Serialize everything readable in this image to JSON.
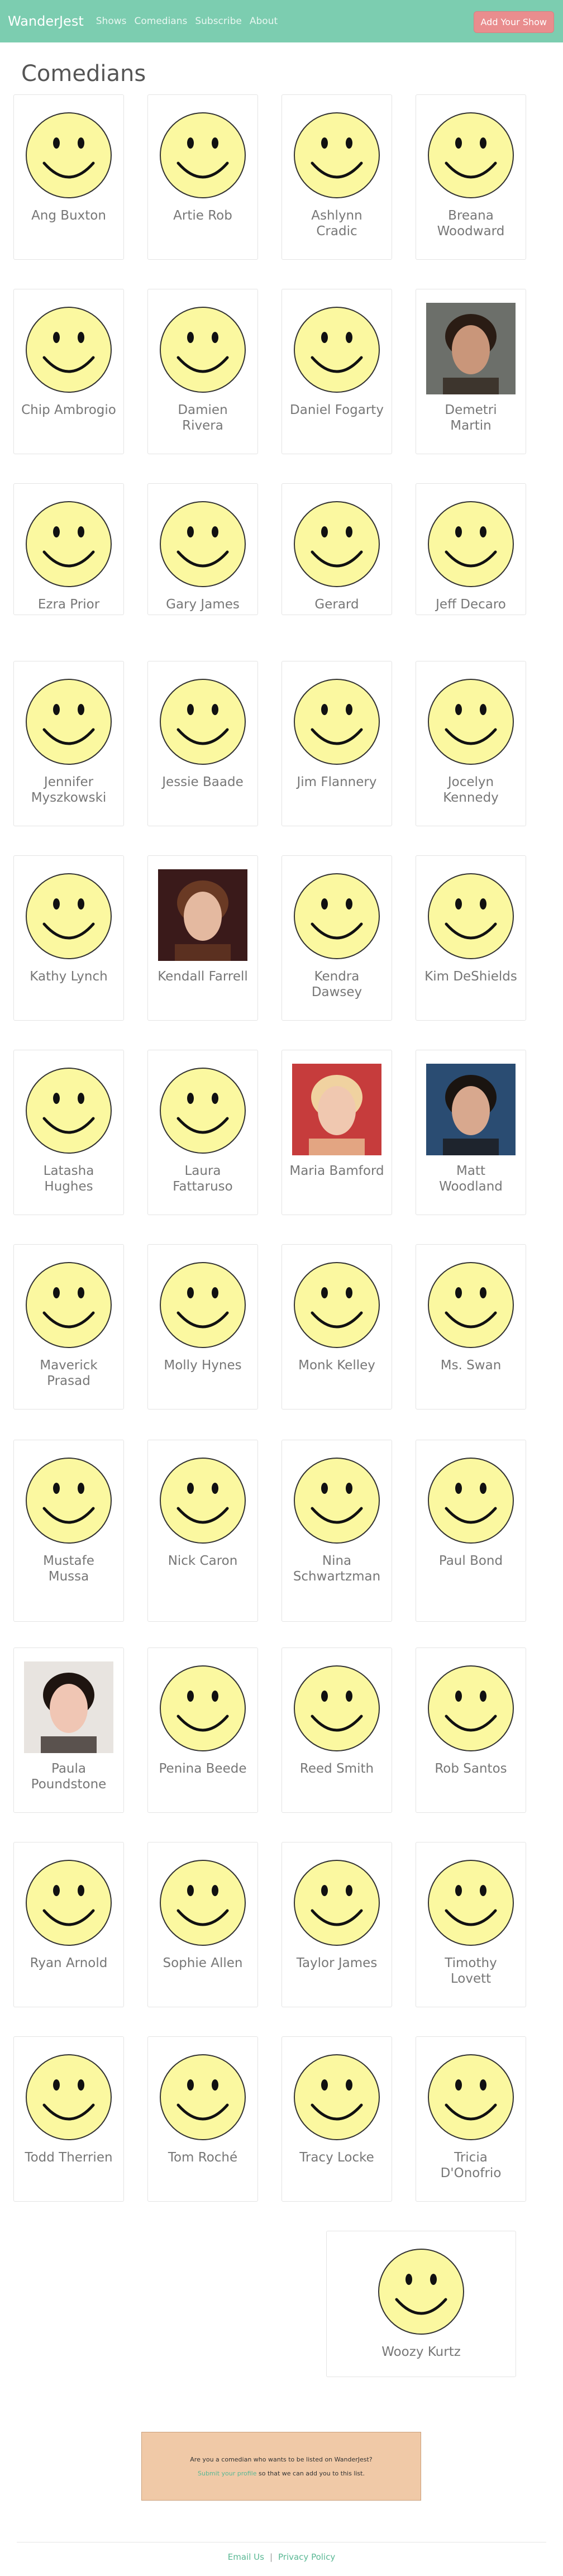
{
  "nav": {
    "brand": "WanderJest",
    "links": [
      "Shows",
      "Comedians",
      "Subscribe",
      "About"
    ],
    "cta": "Add Your Show"
  },
  "page": {
    "title": "Comedians"
  },
  "comedians": [
    {
      "name": "Ang Buxton",
      "photo": "smiley"
    },
    {
      "name": "Artie Rob",
      "photo": "smiley"
    },
    {
      "name": "Ashlynn Cradic",
      "photo": "smiley"
    },
    {
      "name": "Breana Woodward",
      "photo": "smiley"
    },
    {
      "name": "Chip Ambrogio",
      "photo": "smiley"
    },
    {
      "name": "Damien Rivera",
      "photo": "smiley"
    },
    {
      "name": "Daniel Fogarty",
      "photo": "smiley"
    },
    {
      "name": "Demetri Martin",
      "photo": "portrait"
    },
    {
      "name": "Ezra Prior",
      "photo": "smiley"
    },
    {
      "name": "Gary James",
      "photo": "smiley"
    },
    {
      "name": "Gerard",
      "photo": "smiley"
    },
    {
      "name": "Jeff Decaro",
      "photo": "smiley"
    },
    {
      "name": "Jennifer Myszkowski",
      "photo": "smiley"
    },
    {
      "name": "Jessie Baade",
      "photo": "smiley"
    },
    {
      "name": "Jim Flannery",
      "photo": "smiley"
    },
    {
      "name": "Jocelyn Kennedy",
      "photo": "smiley"
    },
    {
      "name": "Kathy Lynch",
      "photo": "smiley"
    },
    {
      "name": "Kendall Farrell",
      "photo": "portrait"
    },
    {
      "name": "Kendra Dawsey",
      "photo": "smiley"
    },
    {
      "name": "Kim DeShields",
      "photo": "smiley"
    },
    {
      "name": "Latasha Hughes",
      "photo": "smiley"
    },
    {
      "name": "Laura Fattaruso",
      "photo": "smiley"
    },
    {
      "name": "Maria Bamford",
      "photo": "portrait"
    },
    {
      "name": "Matt Woodland",
      "photo": "portrait"
    },
    {
      "name": "Maverick Prasad",
      "photo": "smiley"
    },
    {
      "name": "Molly Hynes",
      "photo": "smiley"
    },
    {
      "name": "Monk Kelley",
      "photo": "smiley"
    },
    {
      "name": "Ms. Swan",
      "photo": "smiley"
    },
    {
      "name": "Mustafe Mussa",
      "photo": "smiley"
    },
    {
      "name": "Nick Caron",
      "photo": "smiley"
    },
    {
      "name": "Nina Schwartzman",
      "photo": "smiley"
    },
    {
      "name": "Paul Bond",
      "photo": "smiley"
    },
    {
      "name": "Paula Poundstone",
      "photo": "portrait"
    },
    {
      "name": "Penina Beede",
      "photo": "smiley"
    },
    {
      "name": "Reed Smith",
      "photo": "smiley"
    },
    {
      "name": "Rob Santos",
      "photo": "smiley"
    },
    {
      "name": "Ryan Arnold",
      "photo": "smiley"
    },
    {
      "name": "Sophie Allen",
      "photo": "smiley"
    },
    {
      "name": "Taylor James",
      "photo": "smiley"
    },
    {
      "name": "Timothy Lovett",
      "photo": "smiley"
    },
    {
      "name": "Todd Therrien",
      "photo": "smiley"
    },
    {
      "name": "Tom Roché",
      "photo": "smiley"
    },
    {
      "name": "Tracy Locke",
      "photo": "smiley"
    },
    {
      "name": "Tricia D'Onofrio",
      "photo": "smiley"
    },
    {
      "name": "Woozy Kurtz",
      "photo": "smiley"
    }
  ],
  "cta_box": {
    "line1": "Are you a comedian who wants to be listed on WanderJest?",
    "link": "Submit your profile",
    "line2_rest": " so that we can add you to this list."
  },
  "footer": {
    "email": "Email Us",
    "sep": "|",
    "privacy": "Privacy Policy"
  },
  "colors": {
    "navbar": "#7ccdb0",
    "cta_button": "#e98d8e",
    "cta_box": "#f0c9a7",
    "smiley": "#fbf8a0"
  }
}
